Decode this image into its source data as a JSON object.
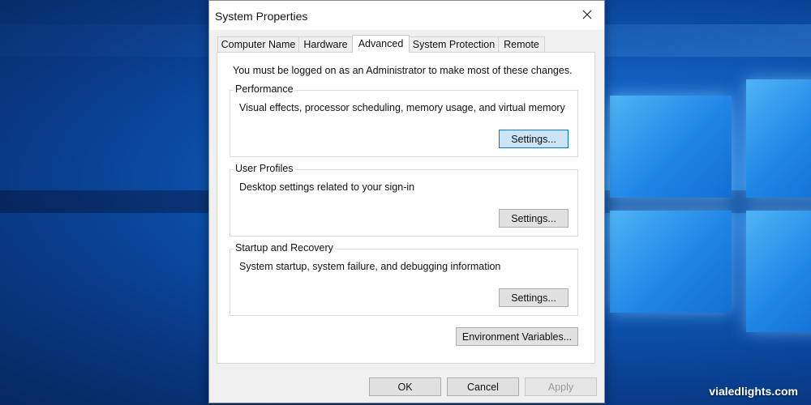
{
  "dialog": {
    "title": "System Properties",
    "close_icon": "close-icon"
  },
  "tabs": [
    {
      "label": "Computer Name"
    },
    {
      "label": "Hardware"
    },
    {
      "label": "Advanced",
      "active": true
    },
    {
      "label": "System Protection"
    },
    {
      "label": "Remote"
    }
  ],
  "advanced": {
    "admin_notice": "You must be logged on as an Administrator to make most of these changes.",
    "performance": {
      "title": "Performance",
      "description": "Visual effects, processor scheduling, memory usage, and virtual memory",
      "button": "Settings..."
    },
    "user_profiles": {
      "title": "User Profiles",
      "description": "Desktop settings related to your sign-in",
      "button": "Settings..."
    },
    "startup_recovery": {
      "title": "Startup and Recovery",
      "description": "System startup, system failure, and debugging information",
      "button": "Settings..."
    },
    "env_button": "Environment Variables..."
  },
  "footer": {
    "ok": "OK",
    "cancel": "Cancel",
    "apply": "Apply"
  },
  "watermark": "vialedlights.com",
  "colors": {
    "focused_button_bg": "#cce4f7",
    "focused_button_border": "#0078d7",
    "desktop_blue": "#0b4aa3"
  }
}
